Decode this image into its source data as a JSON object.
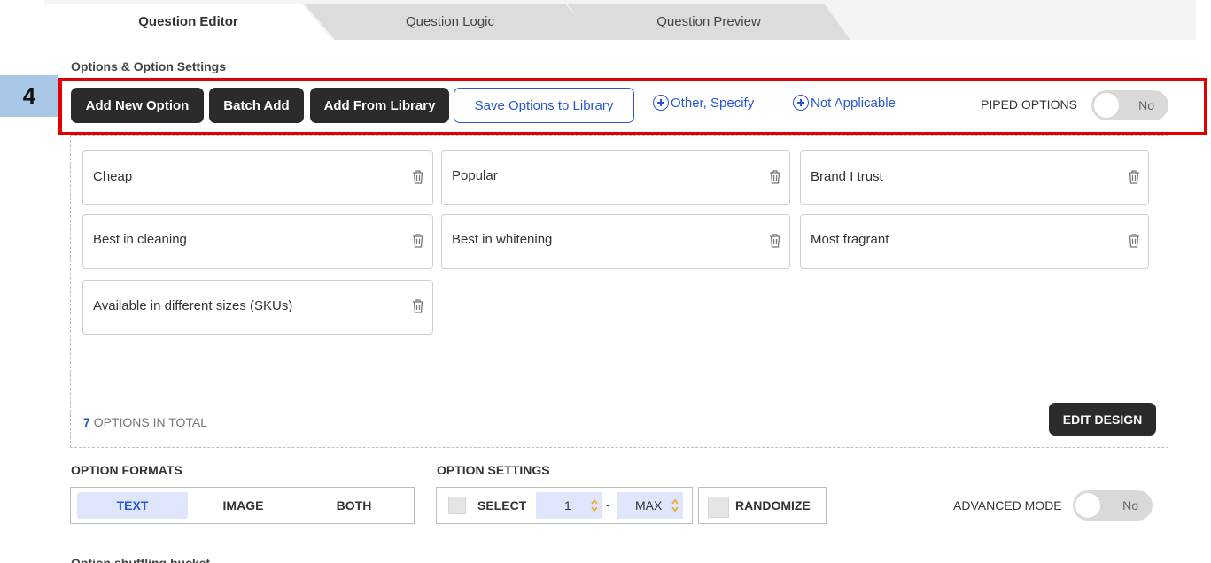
{
  "tabs": [
    {
      "label": "Question Editor",
      "active": true
    },
    {
      "label": "Question Logic",
      "active": false
    },
    {
      "label": "Question Preview",
      "active": false
    }
  ],
  "section_title": "Options & Option Settings",
  "step_badge": "4",
  "toolbar": {
    "add_new_option": "Add New Option",
    "batch_add": "Batch Add",
    "add_from_library": "Add From Library",
    "save_options_to_library": "Save Options to Library",
    "other_specify": "Other, Specify",
    "not_applicable": "Not Applicable",
    "piped_options_label": "PIPED OPTIONS",
    "piped_options_value": "No"
  },
  "options": [
    "Cheap",
    "Popular",
    "Brand I trust",
    "Best in cleaning",
    "Best in whitening",
    "Most fragrant",
    "Available in different sizes (SKUs)"
  ],
  "options_total": {
    "count": "7",
    "label": "OPTIONS IN TOTAL"
  },
  "edit_design": "EDIT DESIGN",
  "option_formats": {
    "title": "OPTION FORMATS",
    "items": [
      "TEXT",
      "IMAGE",
      "BOTH"
    ],
    "selected": "TEXT"
  },
  "option_settings": {
    "title": "OPTION SETTINGS",
    "select_label": "SELECT",
    "min_value": "1",
    "separator": "-",
    "max_value": "MAX",
    "randomize_label": "RANDOMIZE"
  },
  "advanced_mode": {
    "label": "ADVANCED MODE",
    "value": "No"
  },
  "cutoff_text": "Option shuffling bucket",
  "colors": {
    "accent": "#2a56d6",
    "dark_button": "#2b2b2b",
    "highlight": "#e00000",
    "badge": "#a9c7e6"
  }
}
